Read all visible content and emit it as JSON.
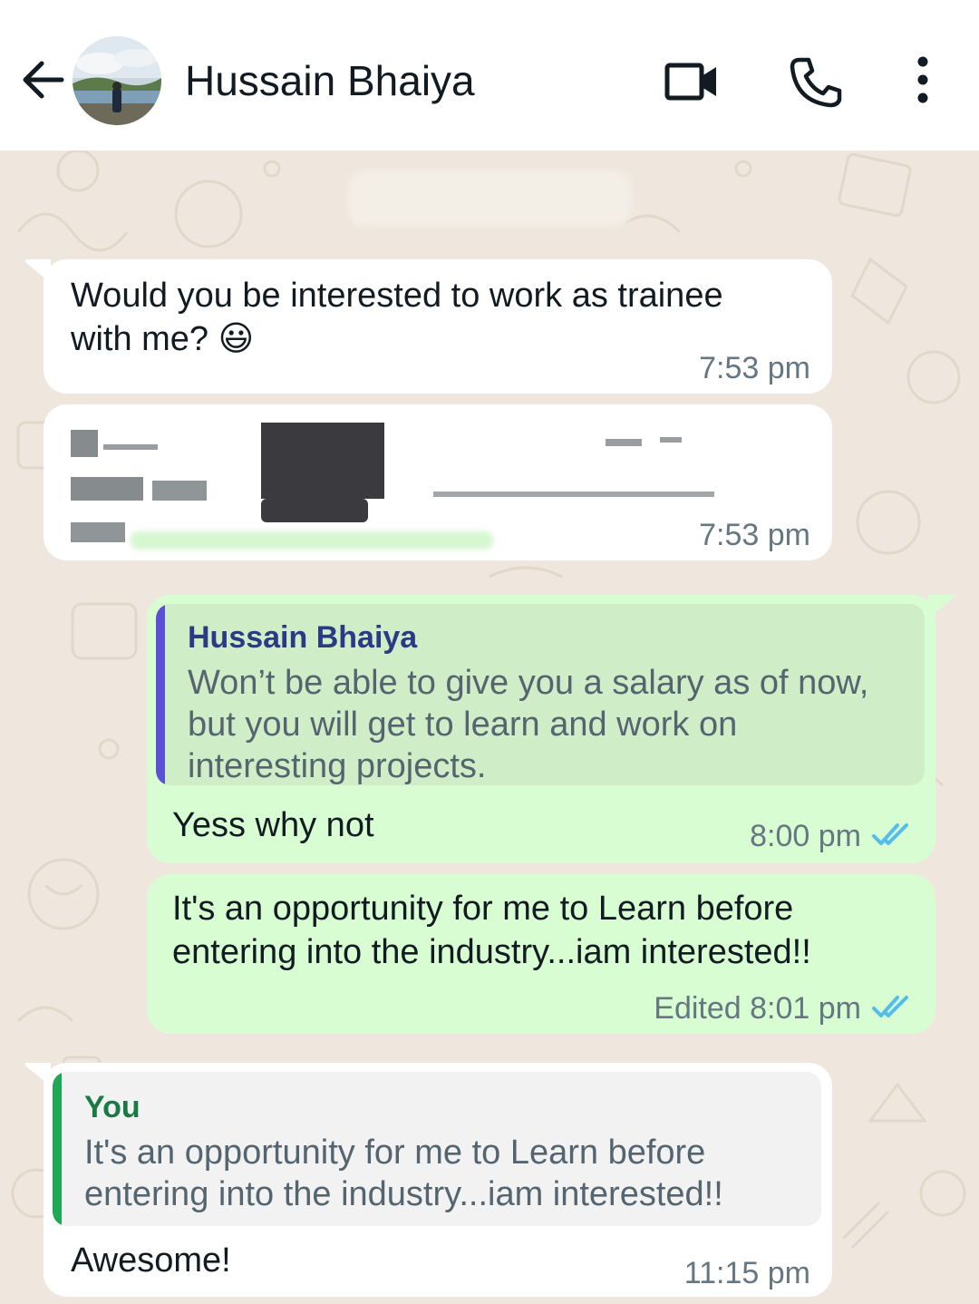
{
  "header": {
    "contact_name": "Hussain Bhaiya",
    "back_icon": "arrow-left-icon",
    "video_icon": "video-camera-icon",
    "call_icon": "phone-icon",
    "menu_icon": "more-vertical-icon"
  },
  "messages": [
    {
      "direction": "incoming",
      "text": "Would you be interested to work as trainee with me? 😃",
      "time": "7:53 pm"
    },
    {
      "direction": "incoming",
      "redacted": true,
      "time": "7:53 pm"
    },
    {
      "direction": "outgoing",
      "reply_to": {
        "author": "Hussain Bhaiya",
        "text": "Won’t be able to give you a salary as of now, but you will get to learn and work on interesting projects."
      },
      "text": "Yess why not",
      "time": "8:00 pm",
      "status": "read"
    },
    {
      "direction": "outgoing",
      "text": "It's an opportunity for me to Learn before entering into the industry...iam interested!!",
      "edited_label": "Edited",
      "time": "8:01 pm",
      "status": "read"
    },
    {
      "direction": "incoming",
      "reply_to": {
        "author": "You",
        "text": "It's an opportunity for me to Learn before entering into the industry...iam interested!!"
      },
      "text": "Awesome!",
      "time": "11:15 pm"
    }
  ],
  "colors": {
    "incoming_bubble": "#ffffff",
    "outgoing_bubble": "#d9fdd3",
    "read_ticks": "#53bdeb",
    "quote_bar_contact": "#5b4fd6",
    "quote_bar_self": "#1fa855",
    "chat_background": "#efe7de"
  }
}
